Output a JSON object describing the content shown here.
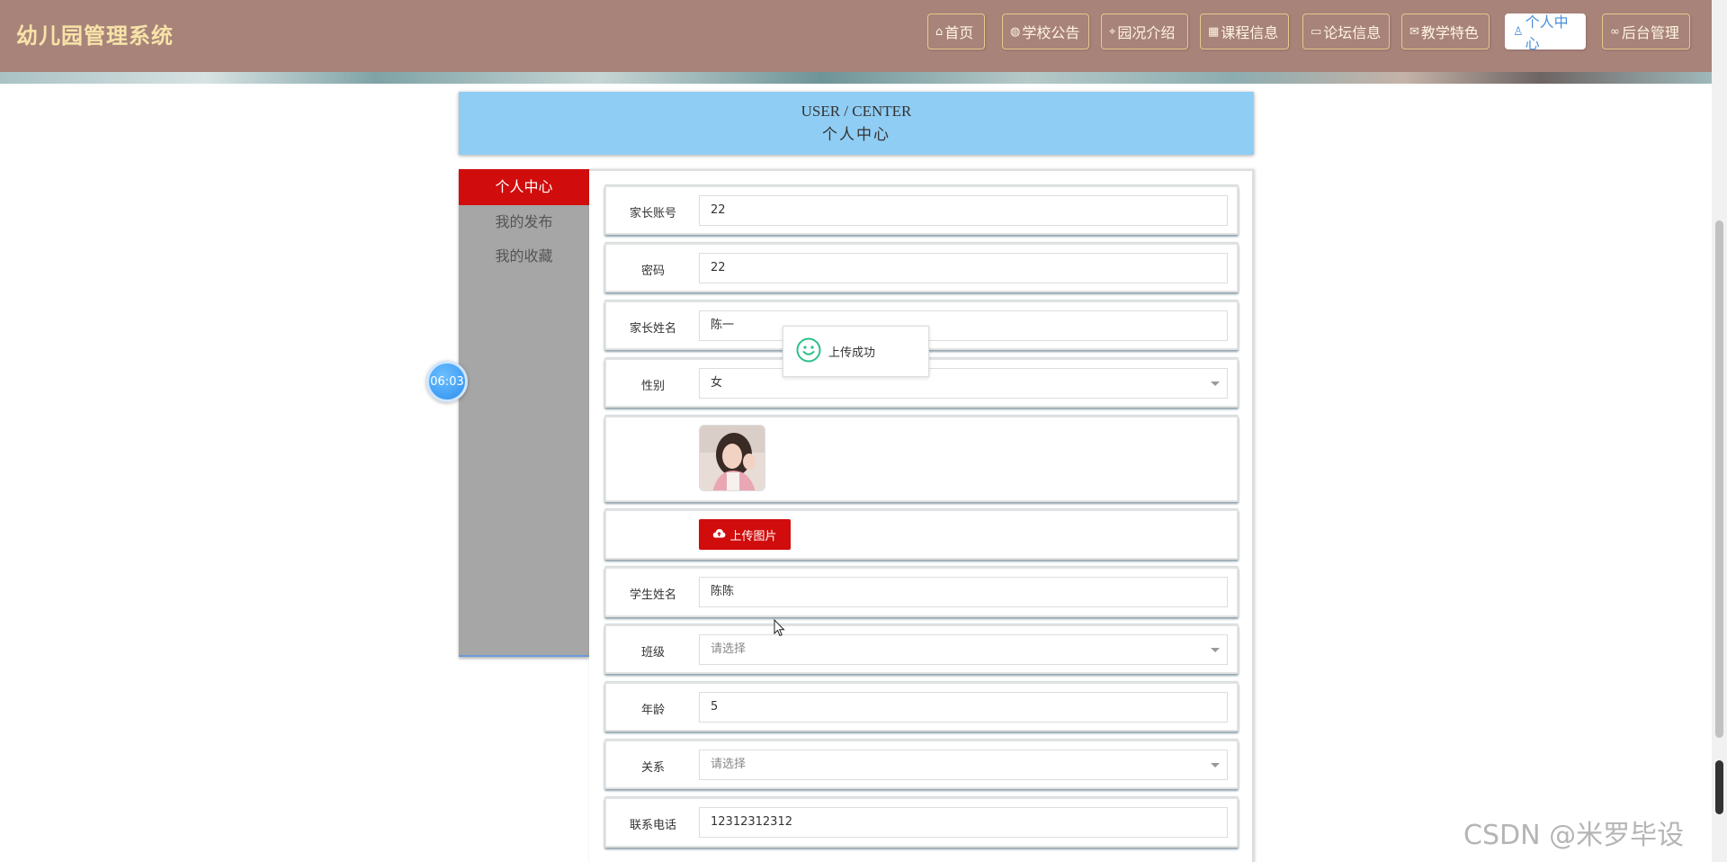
{
  "app": {
    "title": "幼儿园管理系统"
  },
  "nav": {
    "items": [
      {
        "label": "首页",
        "icon": "home-icon"
      },
      {
        "label": "学校公告",
        "icon": "globe-icon"
      },
      {
        "label": "园况介绍",
        "icon": "tag-icon"
      },
      {
        "label": "课程信息",
        "icon": "grid-icon"
      },
      {
        "label": "论坛信息",
        "icon": "book-icon"
      },
      {
        "label": "教学特色",
        "icon": "mail-icon"
      },
      {
        "label": "个人中心",
        "icon": "user-icon",
        "active": true
      },
      {
        "label": "后台管理",
        "icon": "link-icon"
      }
    ]
  },
  "header": {
    "title_en": "USER / CENTER",
    "title_cn": "个人中心"
  },
  "sidebar": {
    "items": [
      {
        "label": "个人中心",
        "active": true
      },
      {
        "label": "我的发布"
      },
      {
        "label": "我的收藏"
      }
    ]
  },
  "form": {
    "parent_account": {
      "label": "家长账号",
      "value": "22"
    },
    "password": {
      "label": "密码",
      "value": "22"
    },
    "parent_name": {
      "label": "家长姓名",
      "value": "陈一"
    },
    "gender": {
      "label": "性别",
      "value": "女"
    },
    "upload_button": "上传图片",
    "student_name": {
      "label": "学生姓名",
      "value": "陈陈"
    },
    "class": {
      "label": "班级",
      "placeholder": "请选择"
    },
    "age": {
      "label": "年龄",
      "value": "5"
    },
    "relation": {
      "label": "关系",
      "placeholder": "请选择"
    },
    "phone": {
      "label": "联系电话",
      "value": "12312312312"
    }
  },
  "toast": {
    "message": "上传成功",
    "icon": "smile-icon"
  },
  "timer": {
    "value": "06:03"
  },
  "watermark": "CSDN @米罗毕设",
  "colors": {
    "nav_bg": "#a8837a",
    "brand": "#f7e3a8",
    "accent_red": "#d10c0c",
    "title_bg": "#90cdf4",
    "sidebar_bg": "#a6a6a6"
  }
}
